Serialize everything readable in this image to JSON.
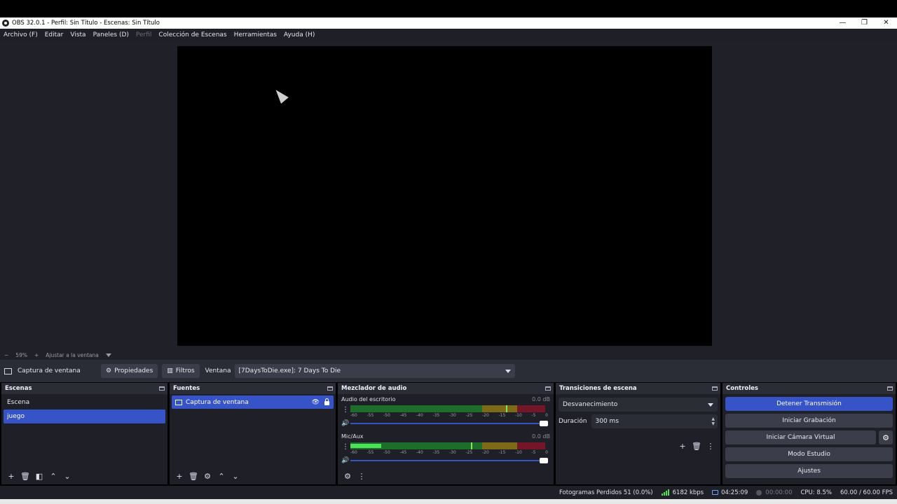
{
  "window": {
    "title": "OBS 32.0.1 - Perfil: Sin Título - Escenas: Sin Título",
    "buttons": [
      "—",
      "❐",
      "✕"
    ]
  },
  "menu": [
    {
      "label": "Archivo (F)",
      "disabled": false
    },
    {
      "label": "Editar",
      "disabled": false
    },
    {
      "label": "Vista",
      "disabled": false
    },
    {
      "label": "Paneles (D)",
      "disabled": false
    },
    {
      "label": "Perfil",
      "disabled": true
    },
    {
      "label": "Colección de Escenas",
      "disabled": false
    },
    {
      "label": "Herramientas",
      "disabled": false
    },
    {
      "label": "Ayuda (H)",
      "disabled": false
    }
  ],
  "zoom": {
    "minus": "−",
    "value": "59%",
    "plus": "+",
    "fit_label": "Ajustar a la ventana"
  },
  "source_toolbar": {
    "source_name": "Captura de ventana",
    "properties_label": "Propiedades",
    "filters_label": "Filtros",
    "window_label": "Ventana",
    "window_value": "[7DaysToDie.exe]: 7 Days To Die"
  },
  "scenes": {
    "title": "Escenas",
    "items": [
      {
        "label": "Escena",
        "active": false
      },
      {
        "label": "juego",
        "active": true
      }
    ]
  },
  "sources": {
    "title": "Fuentes",
    "items": [
      {
        "label": "Captura de ventana"
      }
    ]
  },
  "mixer": {
    "title": "Mezclador de audio",
    "scale": [
      "-60",
      "-55",
      "-50",
      "-45",
      "-40",
      "-35",
      "-30",
      "-25",
      "-20",
      "-15",
      "-10",
      "-5",
      "0"
    ],
    "channels": [
      {
        "name": "Audio del escritorio",
        "db": "0.0 dB",
        "level_fraction": 0.0,
        "peak_fraction": 0.8
      },
      {
        "name": "Mic/Aux",
        "db": "0.0 dB",
        "level_fraction": 0.16,
        "peak_fraction": 0.62
      }
    ]
  },
  "transitions": {
    "title": "Transiciones de escena",
    "selected": "Desvanecimiento",
    "duration_label": "Duración",
    "duration_value": "300 ms"
  },
  "controls": {
    "title": "Controles",
    "stop_stream": "Detener Transmisión",
    "start_recording": "Iniciar Grabación",
    "start_virtualcam": "Iniciar Cámara Virtual",
    "studio_mode": "Modo Estudio",
    "settings": "Ajustes"
  },
  "status": {
    "dropped_frames": "Fotogramas Perdidos 51 (0.0%)",
    "bitrate": "6182 kbps",
    "stream_time": "04:25:09",
    "rec_time": "00:00:00",
    "cpu": "CPU: 8.5%",
    "fps": "60.00 / 60.00 FPS"
  }
}
